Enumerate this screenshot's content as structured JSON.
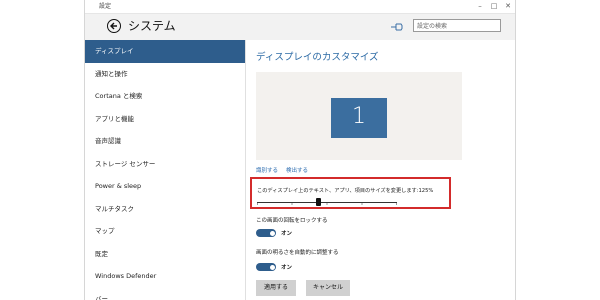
{
  "window": {
    "title": "設定"
  },
  "header": {
    "title": "システム",
    "search_placeholder": "設定の検索"
  },
  "sidebar": {
    "items": [
      {
        "label": "ディスプレイ",
        "active": true
      },
      {
        "label": "通知と操作"
      },
      {
        "label": "Cortana と検索"
      },
      {
        "label": "アプリと機能"
      },
      {
        "label": "音声認識"
      },
      {
        "label": "ストレージ センサー"
      },
      {
        "label": "Power & sleep"
      },
      {
        "label": "マルチタスク"
      },
      {
        "label": "マップ"
      },
      {
        "label": "既定"
      },
      {
        "label": "Windows Defender"
      },
      {
        "label": "バー"
      }
    ]
  },
  "content": {
    "title": "ディスプレイのカスタマイズ",
    "monitor_number": "1",
    "links": {
      "identify": "識別する",
      "detect": "検出する"
    },
    "scale": {
      "label": "このディスプレイ上のテキスト、アプリ、項目のサイズを変更します:125%",
      "value_percent": 125
    },
    "rotation_lock": {
      "label": "この画面の回転をロックする",
      "state": "オン"
    },
    "auto_brightness": {
      "label": "画面の明るさを自動的に調整する",
      "state": "オン"
    },
    "buttons": {
      "apply": "適用する",
      "cancel": "キャンセル"
    }
  },
  "colors": {
    "accent": "#2e5d8c",
    "monitor": "#3b6e9f",
    "title": "#2c6aa5",
    "highlight": "#d32b2b"
  }
}
